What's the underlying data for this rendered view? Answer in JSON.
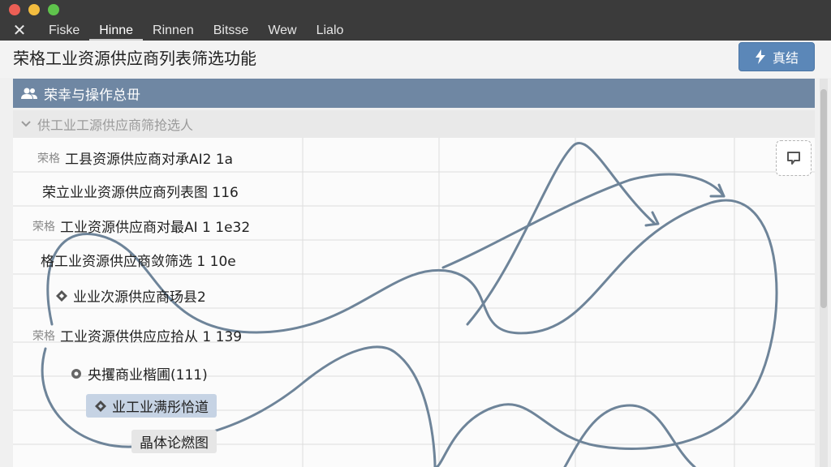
{
  "window": {
    "menu": [
      "Fiske",
      "Hinne",
      "Rinnen",
      "Bitsse",
      "Wew",
      "Lialo"
    ]
  },
  "header": {
    "title": "荣格工业资源供应商列表筛选功能",
    "action_label": "真结"
  },
  "panel": {
    "title": "荣幸与操作总毌",
    "filter_label": "供工业工源供应商筛抢选人"
  },
  "tree": {
    "rows": [
      {
        "prefix": "荣格",
        "text": "工县资源供应商对承AI2 1a"
      },
      {
        "prefix": "",
        "text": "荣立业业资源供应商列表图 116"
      },
      {
        "prefix": "荣格",
        "text": "工业资源供应商对最AI 1 1e32"
      },
      {
        "prefix": "",
        "text": "格工业资源供应商敛筛选 1 10e"
      },
      {
        "prefix": "",
        "text": "业业次源供应商玚县2"
      },
      {
        "prefix": "荣格",
        "text": "工业资源供供应应拾从 1 139"
      },
      {
        "prefix": "",
        "text": "央攫商业楷圃(111)"
      },
      {
        "prefix": "",
        "text": "业工业满彤恰道"
      },
      {
        "prefix": "",
        "text": "晶体论燃图"
      }
    ]
  },
  "colors": {
    "accent": "#5b87b8",
    "panel_header": "#6f87a3",
    "selected": "#c6d3e4"
  },
  "icons": {
    "close": "close-icon",
    "action": "bolt-icon",
    "panel": "users-icon",
    "filter": "chevron-down-icon",
    "tree": "diamond-icon",
    "comment": "comment-icon"
  }
}
